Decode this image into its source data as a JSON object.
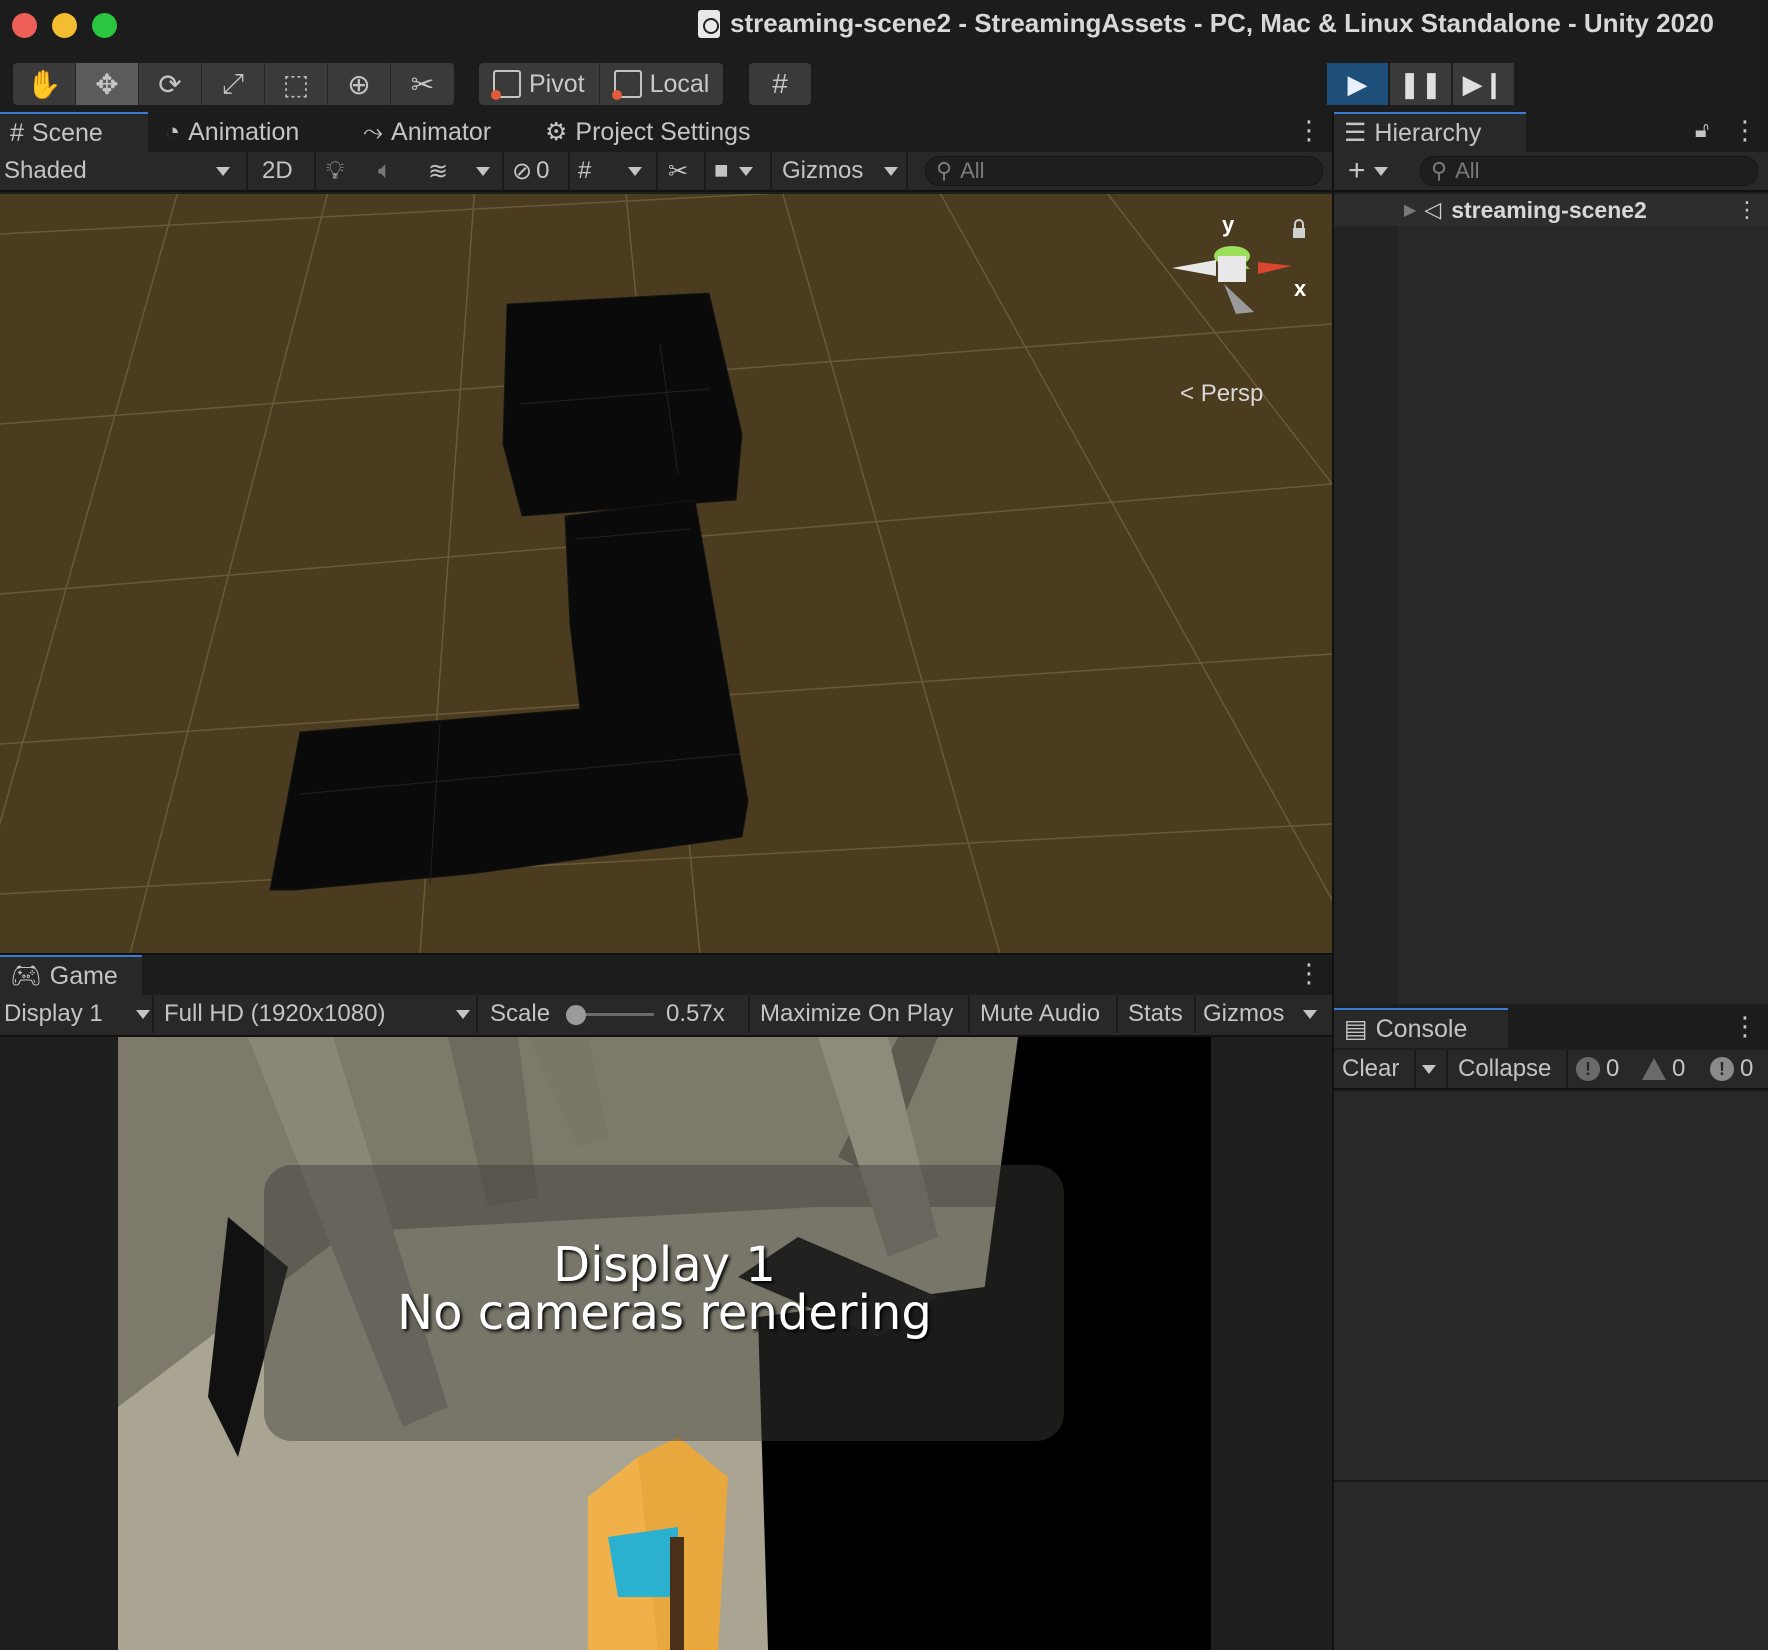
{
  "window": {
    "title": "streaming-scene2 - StreamingAssets - PC, Mac & Linux Standalone - Unity 2020"
  },
  "toolbar": {
    "tools": [
      {
        "name": "hand-tool",
        "icon": "hand-icon",
        "glyph": "✋"
      },
      {
        "name": "move-tool",
        "icon": "move-icon",
        "glyph": "✥"
      },
      {
        "name": "rotate-tool",
        "icon": "rotate-icon",
        "glyph": "⟳"
      },
      {
        "name": "scale-tool",
        "icon": "scale-icon",
        "glyph": "⤢"
      },
      {
        "name": "rect-tool",
        "icon": "rect-icon",
        "glyph": "⬚"
      },
      {
        "name": "transform-tool",
        "icon": "transform-icon",
        "glyph": "⊕"
      },
      {
        "name": "custom-tool",
        "icon": "tools-icon",
        "glyph": "✂"
      }
    ],
    "pivot_label": "Pivot",
    "local_label": "Local",
    "snap_glyph": "#"
  },
  "tabs": {
    "scene": "Scene",
    "animation": "Animation",
    "animator": "Animator",
    "project_settings": "Project Settings",
    "hierarchy": "Hierarchy",
    "game": "Game",
    "console": "Console"
  },
  "scene_toolbar": {
    "draw_mode": "Shaded",
    "two_d": "2D",
    "hidden_count": "0",
    "gizmos": "Gizmos",
    "search_placeholder": "All"
  },
  "scene_view": {
    "projection_label": "Persp",
    "axis_x": "x",
    "axis_y": "y",
    "colors": {
      "ground": "#4b3b1f",
      "grid": "#6b5a38",
      "mesh": "#0a0a0a"
    }
  },
  "hierarchy": {
    "search_placeholder": "All",
    "items": [
      {
        "label": "streaming-scene2"
      }
    ]
  },
  "game_toolbar": {
    "display": "Display 1",
    "resolution": "Full HD (1920x1080)",
    "scale_label": "Scale",
    "scale_value": "0.57x",
    "scale_slider_fraction": 0.0,
    "maximize": "Maximize On Play",
    "mute": "Mute Audio",
    "stats": "Stats",
    "gizmos": "Gizmos"
  },
  "game_view": {
    "message_line1": "Display 1",
    "message_line2": "No cameras rendering"
  },
  "console": {
    "clear": "Clear",
    "collapse": "Collapse",
    "info_count": "0",
    "warning_count": "0",
    "error_count": "0"
  },
  "colors": {
    "accent": "#3c7ad4",
    "play_active": "#1d4f7a"
  }
}
